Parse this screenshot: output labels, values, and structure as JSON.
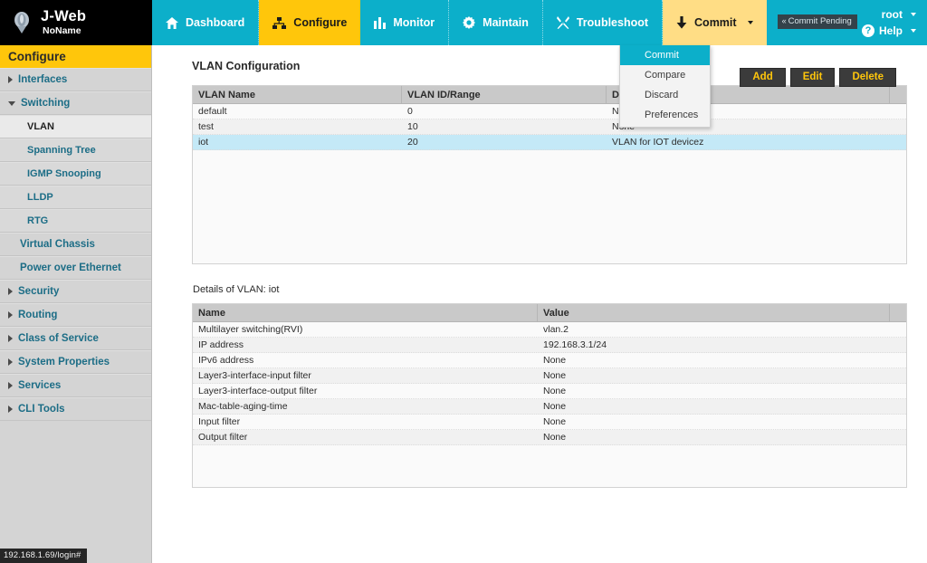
{
  "brand": {
    "title": "J-Web",
    "subtitle": "NoName",
    "logo_icon": "juniper-logo-icon"
  },
  "topnav": {
    "items": [
      {
        "label": "Dashboard",
        "icon": "home-icon",
        "state": "normal"
      },
      {
        "label": "Configure",
        "icon": "sitemap-icon",
        "state": "active"
      },
      {
        "label": "Monitor",
        "icon": "bar-chart-icon",
        "state": "normal"
      },
      {
        "label": "Maintain",
        "icon": "gear-icon",
        "state": "normal"
      },
      {
        "label": "Troubleshoot",
        "icon": "tools-icon",
        "state": "normal"
      },
      {
        "label": "Commit",
        "icon": "download-arrow-icon",
        "state": "open",
        "has_caret": true
      }
    ],
    "commit_pending_badge": "Commit Pending",
    "commit_pending_chevron": "«",
    "user_label": "root",
    "help_label": "Help",
    "help_icon": "question-circle-icon"
  },
  "commit_menu": {
    "items": [
      {
        "label": "Commit",
        "selected": true
      },
      {
        "label": "Compare",
        "selected": false
      },
      {
        "label": "Discard",
        "selected": false
      },
      {
        "label": "Preferences",
        "selected": false
      }
    ]
  },
  "sidebar": {
    "header": "Configure",
    "items": [
      {
        "label": "Interfaces",
        "level": 1,
        "expander": "right",
        "current": false
      },
      {
        "label": "Switching",
        "level": 1,
        "expander": "down",
        "current": false
      },
      {
        "label": "VLAN",
        "level": 3,
        "expander": "none",
        "current": true
      },
      {
        "label": "Spanning Tree",
        "level": 3,
        "expander": "none",
        "current": false
      },
      {
        "label": "IGMP Snooping",
        "level": 3,
        "expander": "none",
        "current": false
      },
      {
        "label": "LLDP",
        "level": 3,
        "expander": "none",
        "current": false
      },
      {
        "label": "RTG",
        "level": 3,
        "expander": "none",
        "current": false
      },
      {
        "label": "Virtual Chassis",
        "level": 2,
        "expander": "none",
        "current": false
      },
      {
        "label": "Power over Ethernet",
        "level": 2,
        "expander": "none",
        "current": false
      },
      {
        "label": "Security",
        "level": 1,
        "expander": "right",
        "current": false
      },
      {
        "label": "Routing",
        "level": 1,
        "expander": "right",
        "current": false
      },
      {
        "label": "Class of Service",
        "level": 1,
        "expander": "right",
        "current": false
      },
      {
        "label": "System Properties",
        "level": 1,
        "expander": "right",
        "current": false
      },
      {
        "label": "Services",
        "level": 1,
        "expander": "right",
        "current": false
      },
      {
        "label": "CLI Tools",
        "level": 1,
        "expander": "right",
        "current": false
      }
    ]
  },
  "main": {
    "page_title": "VLAN Configuration",
    "buttons": [
      {
        "label": "Add"
      },
      {
        "label": "Edit"
      },
      {
        "label": "Delete"
      }
    ],
    "vlan_table": {
      "columns": [
        "VLAN Name",
        "VLAN ID/Range",
        "Description"
      ],
      "rows": [
        {
          "cells": [
            "default",
            "0",
            "None"
          ],
          "selected": false
        },
        {
          "cells": [
            "test",
            "10",
            "None"
          ],
          "selected": false
        },
        {
          "cells": [
            "iot",
            "20",
            "VLAN for IOT devicez"
          ],
          "selected": true
        }
      ]
    },
    "detail_label": "Details of VLAN: iot",
    "detail_table": {
      "columns": [
        "Name",
        "Value"
      ],
      "rows": [
        {
          "cells": [
            "Multilayer switching(RVI)",
            "vlan.2"
          ]
        },
        {
          "cells": [
            "IP address",
            "192.168.3.1/24"
          ]
        },
        {
          "cells": [
            "IPv6 address",
            "None"
          ]
        },
        {
          "cells": [
            "Layer3-interface-input filter",
            "None"
          ]
        },
        {
          "cells": [
            "Layer3-interface-output filter",
            "None"
          ]
        },
        {
          "cells": [
            "Mac-table-aging-time",
            "None"
          ]
        },
        {
          "cells": [
            "Input filter",
            "None"
          ]
        },
        {
          "cells": [
            "Output filter",
            "None"
          ]
        }
      ]
    }
  },
  "status_bar": {
    "url": "192.168.1.69/login#"
  },
  "colors": {
    "teal": "#0cafca",
    "yellow": "#ffc60b",
    "yellow_light": "#ffdd85",
    "dark": "#000000",
    "sidebar_bg": "#d4d4d4",
    "selected_row": "#c4e9f7",
    "button_bg": "#3b3b3b",
    "button_text": "#ffc60b"
  }
}
